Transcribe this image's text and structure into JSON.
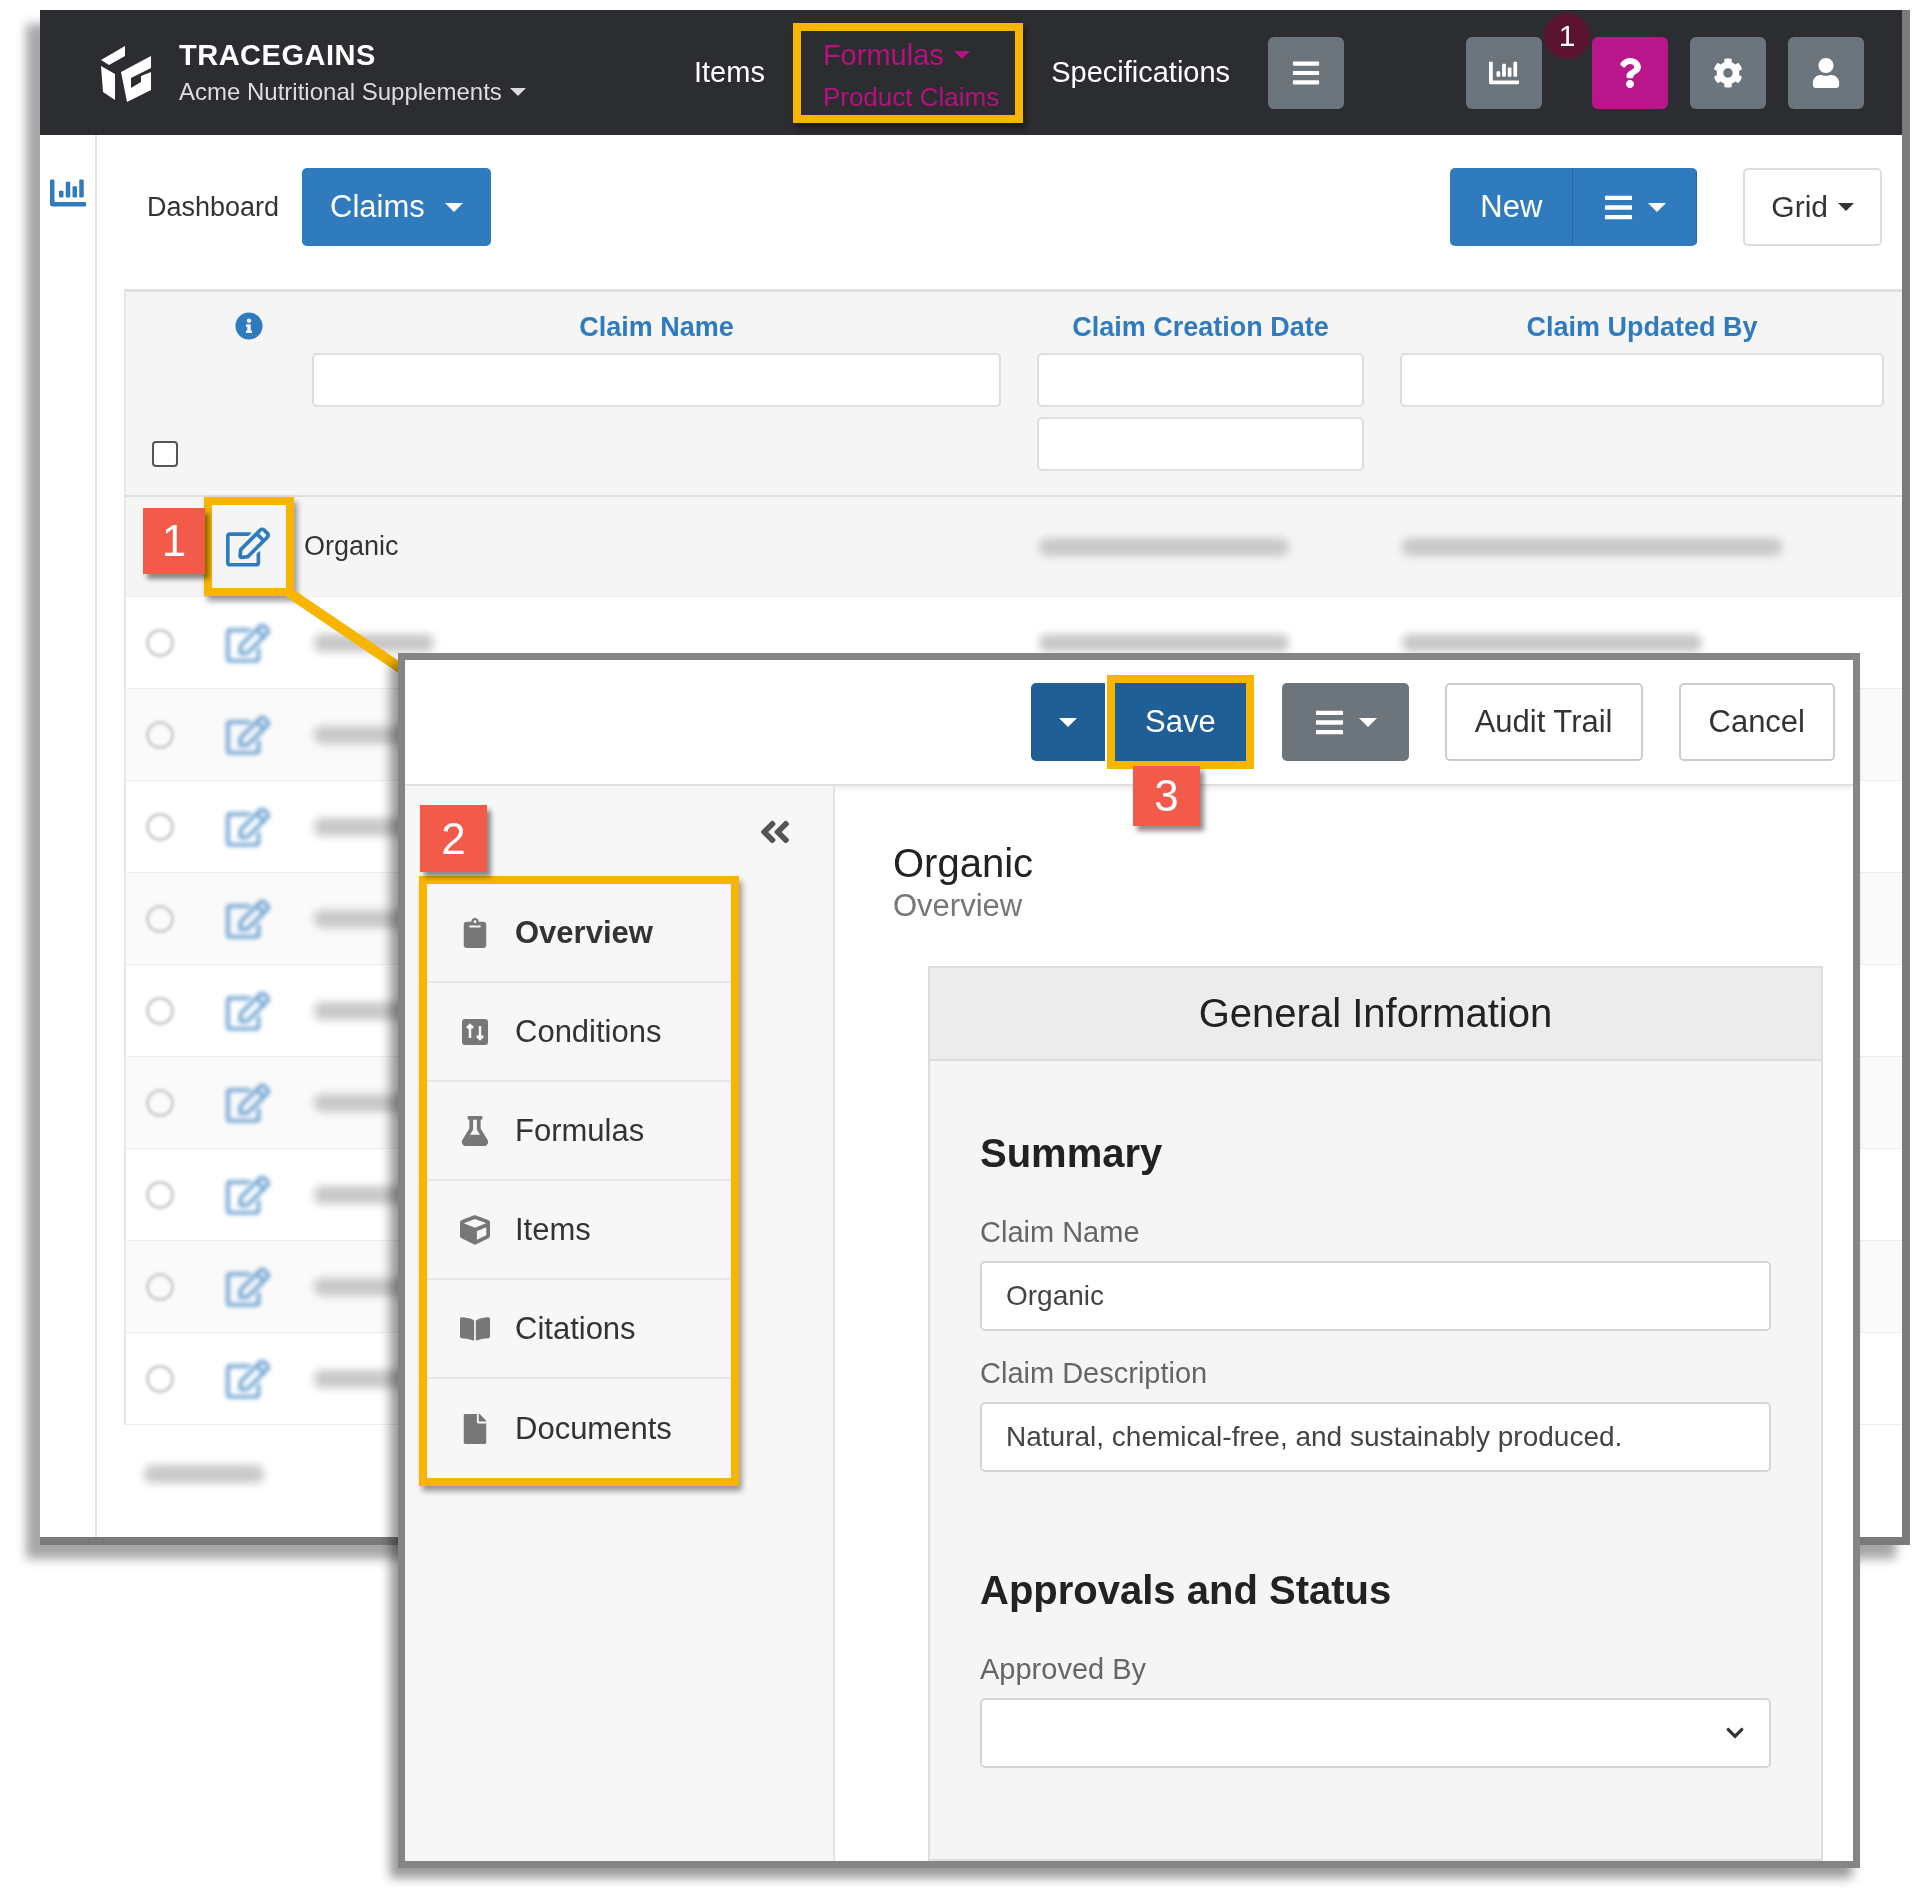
{
  "header": {
    "brand": "TRACEGAINS",
    "company": "Acme Nutritional Supplements",
    "help_badge": "1",
    "nav": [
      {
        "label": "Items",
        "selected": false
      },
      {
        "label": "Formulas",
        "selected": true,
        "sublabel": "Product Claims"
      },
      {
        "label": "Specifications",
        "selected": false
      }
    ]
  },
  "toolbar": {
    "breadcrumb": "Dashboard",
    "view": "Claims",
    "new": "New",
    "layout": "Grid"
  },
  "table": {
    "columns": [
      "Claim Name",
      "Claim Creation Date",
      "Claim Updated By"
    ],
    "select_all": {
      "checked": false
    },
    "rows": [
      {
        "kind": "row",
        "name": "Organic"
      },
      {
        "kind": "blurred",
        "checked": false
      },
      {
        "kind": "blurred",
        "checked": false
      },
      {
        "kind": "blurred",
        "checked": false
      },
      {
        "kind": "blurred",
        "checked": false
      },
      {
        "kind": "blurred",
        "checked": false
      },
      {
        "kind": "blurred",
        "checked": false
      },
      {
        "kind": "blurred",
        "checked": false
      },
      {
        "kind": "blurred",
        "checked": false
      },
      {
        "kind": "blurred",
        "checked": false
      }
    ]
  },
  "callouts": [
    "1",
    "2",
    "3"
  ],
  "editor": {
    "save": "Save",
    "audit": "Audit Trail",
    "cancel": "Cancel",
    "nav": [
      {
        "label": "Overview",
        "selected": true
      },
      {
        "label": "Conditions",
        "selected": false
      },
      {
        "label": "Formulas",
        "selected": false
      },
      {
        "label": "Items",
        "selected": false
      },
      {
        "label": "Citations",
        "selected": false
      },
      {
        "label": "Documents",
        "selected": false
      }
    ],
    "title": "Organic",
    "subtitle": "Overview",
    "panel": {
      "title": "General Information",
      "sections": [
        {
          "title": "Summary",
          "fields": [
            {
              "kind": "text",
              "label": "Claim Name",
              "value": "Organic"
            },
            {
              "kind": "text",
              "label": "Claim Description",
              "value": "Natural, chemical-free, and sustainably produced."
            }
          ]
        },
        {
          "title": "Approvals and Status",
          "fields": [
            {
              "kind": "select",
              "label": "Approved By"
            }
          ]
        }
      ]
    }
  }
}
